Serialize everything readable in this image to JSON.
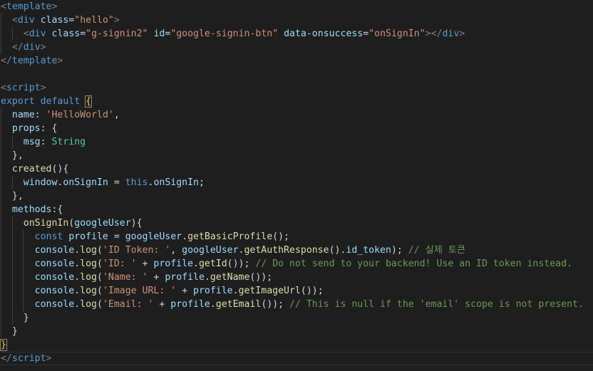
{
  "editor": {
    "theme_colors": {
      "background": "#1e1e1e",
      "tag": "#808080",
      "keyword": "#569cd6",
      "attribute": "#9cdcfe",
      "string": "#ce9178",
      "type": "#4ec9b0",
      "function": "#dcdcaa",
      "comment": "#6a9955"
    },
    "current_line": 26,
    "lines": [
      [
        [
          "tag",
          "<"
        ],
        [
          "tagname",
          "template"
        ],
        [
          "tag",
          ">"
        ]
      ],
      [
        [
          "ws",
          "  "
        ],
        [
          "tag",
          "<"
        ],
        [
          "tagname",
          "div"
        ],
        [
          "ws",
          " "
        ],
        [
          "attr",
          "class"
        ],
        [
          "punct",
          "="
        ],
        [
          "str",
          "\"hello\""
        ],
        [
          "tag",
          ">"
        ]
      ],
      [
        [
          "ws",
          "    "
        ],
        [
          "tag",
          "<"
        ],
        [
          "tagname",
          "div"
        ],
        [
          "ws",
          " "
        ],
        [
          "attr",
          "class"
        ],
        [
          "punct",
          "="
        ],
        [
          "str",
          "\"g-signin2\""
        ],
        [
          "ws",
          " "
        ],
        [
          "attr",
          "id"
        ],
        [
          "punct",
          "="
        ],
        [
          "str",
          "\"google-signin-btn\""
        ],
        [
          "ws",
          " "
        ],
        [
          "attr",
          "data-onsuccess"
        ],
        [
          "punct",
          "="
        ],
        [
          "str",
          "\"onSignIn\""
        ],
        [
          "tag",
          "></"
        ],
        [
          "tagname",
          "div"
        ],
        [
          "tag",
          ">"
        ]
      ],
      [
        [
          "ws",
          "  "
        ],
        [
          "tag",
          "</"
        ],
        [
          "tagname",
          "div"
        ],
        [
          "tag",
          ">"
        ]
      ],
      [
        [
          "tag",
          "</"
        ],
        [
          "tagname",
          "template"
        ],
        [
          "tag",
          ">"
        ]
      ],
      [],
      [
        [
          "tag",
          "<"
        ],
        [
          "tagname",
          "script"
        ],
        [
          "tag",
          ">"
        ]
      ],
      [
        [
          "kw",
          "export"
        ],
        [
          "ws",
          " "
        ],
        [
          "kw",
          "default"
        ],
        [
          "ws",
          " "
        ],
        [
          "bracket",
          "{"
        ]
      ],
      [
        [
          "ws",
          "  "
        ],
        [
          "key",
          "name"
        ],
        [
          "punct",
          ": "
        ],
        [
          "str",
          "'HelloWorld'"
        ],
        [
          "punct",
          ","
        ]
      ],
      [
        [
          "ws",
          "  "
        ],
        [
          "key",
          "props"
        ],
        [
          "punct",
          ": {"
        ]
      ],
      [
        [
          "ws",
          "    "
        ],
        [
          "key",
          "msg"
        ],
        [
          "punct",
          ": "
        ],
        [
          "type",
          "String"
        ]
      ],
      [
        [
          "ws",
          "  "
        ],
        [
          "punct",
          "},"
        ]
      ],
      [
        [
          "ws",
          "  "
        ],
        [
          "fn",
          "created"
        ],
        [
          "punct",
          "(){"
        ]
      ],
      [
        [
          "ws",
          "    "
        ],
        [
          "var",
          "window"
        ],
        [
          "punct",
          "."
        ],
        [
          "var",
          "onSignIn"
        ],
        [
          "punct",
          " = "
        ],
        [
          "kw",
          "this"
        ],
        [
          "punct",
          "."
        ],
        [
          "var",
          "onSignIn"
        ],
        [
          "punct",
          ";"
        ]
      ],
      [
        [
          "ws",
          "  "
        ],
        [
          "punct",
          "},"
        ]
      ],
      [
        [
          "ws",
          "  "
        ],
        [
          "key",
          "methods"
        ],
        [
          "punct",
          ":{"
        ]
      ],
      [
        [
          "ws",
          "    "
        ],
        [
          "fn",
          "onSignIn"
        ],
        [
          "punct",
          "("
        ],
        [
          "var",
          "googleUser"
        ],
        [
          "punct",
          "){"
        ]
      ],
      [
        [
          "ws",
          "      "
        ],
        [
          "kw",
          "const"
        ],
        [
          "ws",
          " "
        ],
        [
          "var",
          "profile"
        ],
        [
          "punct",
          " = "
        ],
        [
          "var",
          "googleUser"
        ],
        [
          "punct",
          "."
        ],
        [
          "fn",
          "getBasicProfile"
        ],
        [
          "punct",
          "();"
        ]
      ],
      [
        [
          "ws",
          "      "
        ],
        [
          "var",
          "console"
        ],
        [
          "punct",
          "."
        ],
        [
          "fn",
          "log"
        ],
        [
          "punct",
          "("
        ],
        [
          "str",
          "'ID Token: '"
        ],
        [
          "punct",
          ", "
        ],
        [
          "var",
          "googleUser"
        ],
        [
          "punct",
          "."
        ],
        [
          "fn",
          "getAuthResponse"
        ],
        [
          "punct",
          "()."
        ],
        [
          "var",
          "id_token"
        ],
        [
          "punct",
          ");"
        ],
        [
          "ws",
          " "
        ],
        [
          "comment",
          "// 실제 토큰"
        ]
      ],
      [
        [
          "ws",
          "      "
        ],
        [
          "var",
          "console"
        ],
        [
          "punct",
          "."
        ],
        [
          "fn",
          "log"
        ],
        [
          "punct",
          "("
        ],
        [
          "str",
          "'ID: '"
        ],
        [
          "punct",
          " + "
        ],
        [
          "var",
          "profile"
        ],
        [
          "punct",
          "."
        ],
        [
          "fn",
          "getId"
        ],
        [
          "punct",
          "());"
        ],
        [
          "ws",
          " "
        ],
        [
          "comment",
          "// Do not send to your backend! Use an ID token instead."
        ]
      ],
      [
        [
          "ws",
          "      "
        ],
        [
          "var",
          "console"
        ],
        [
          "punct",
          "."
        ],
        [
          "fn",
          "log"
        ],
        [
          "punct",
          "("
        ],
        [
          "str",
          "'Name: '"
        ],
        [
          "punct",
          " + "
        ],
        [
          "var",
          "profile"
        ],
        [
          "punct",
          "."
        ],
        [
          "fn",
          "getName"
        ],
        [
          "punct",
          "());"
        ]
      ],
      [
        [
          "ws",
          "      "
        ],
        [
          "var",
          "console"
        ],
        [
          "punct",
          "."
        ],
        [
          "fn",
          "log"
        ],
        [
          "punct",
          "("
        ],
        [
          "str",
          "'Image URL: '"
        ],
        [
          "punct",
          " + "
        ],
        [
          "var",
          "profile"
        ],
        [
          "punct",
          "."
        ],
        [
          "fn",
          "getImageUrl"
        ],
        [
          "punct",
          "());"
        ]
      ],
      [
        [
          "ws",
          "      "
        ],
        [
          "var",
          "console"
        ],
        [
          "punct",
          "."
        ],
        [
          "fn",
          "log"
        ],
        [
          "punct",
          "("
        ],
        [
          "str",
          "'Email: '"
        ],
        [
          "punct",
          " + "
        ],
        [
          "var",
          "profile"
        ],
        [
          "punct",
          "."
        ],
        [
          "fn",
          "getEmail"
        ],
        [
          "punct",
          "());"
        ],
        [
          "ws",
          " "
        ],
        [
          "comment",
          "// This is null if the 'email' scope is not present."
        ]
      ],
      [
        [
          "ws",
          "    "
        ],
        [
          "punct",
          "}"
        ]
      ],
      [
        [
          "ws",
          "  "
        ],
        [
          "punct",
          "}"
        ]
      ],
      [
        [
          "bracket",
          "}"
        ]
      ],
      [
        [
          "tag",
          "</"
        ],
        [
          "tagname",
          "script"
        ],
        [
          "tag",
          ">"
        ]
      ]
    ]
  }
}
